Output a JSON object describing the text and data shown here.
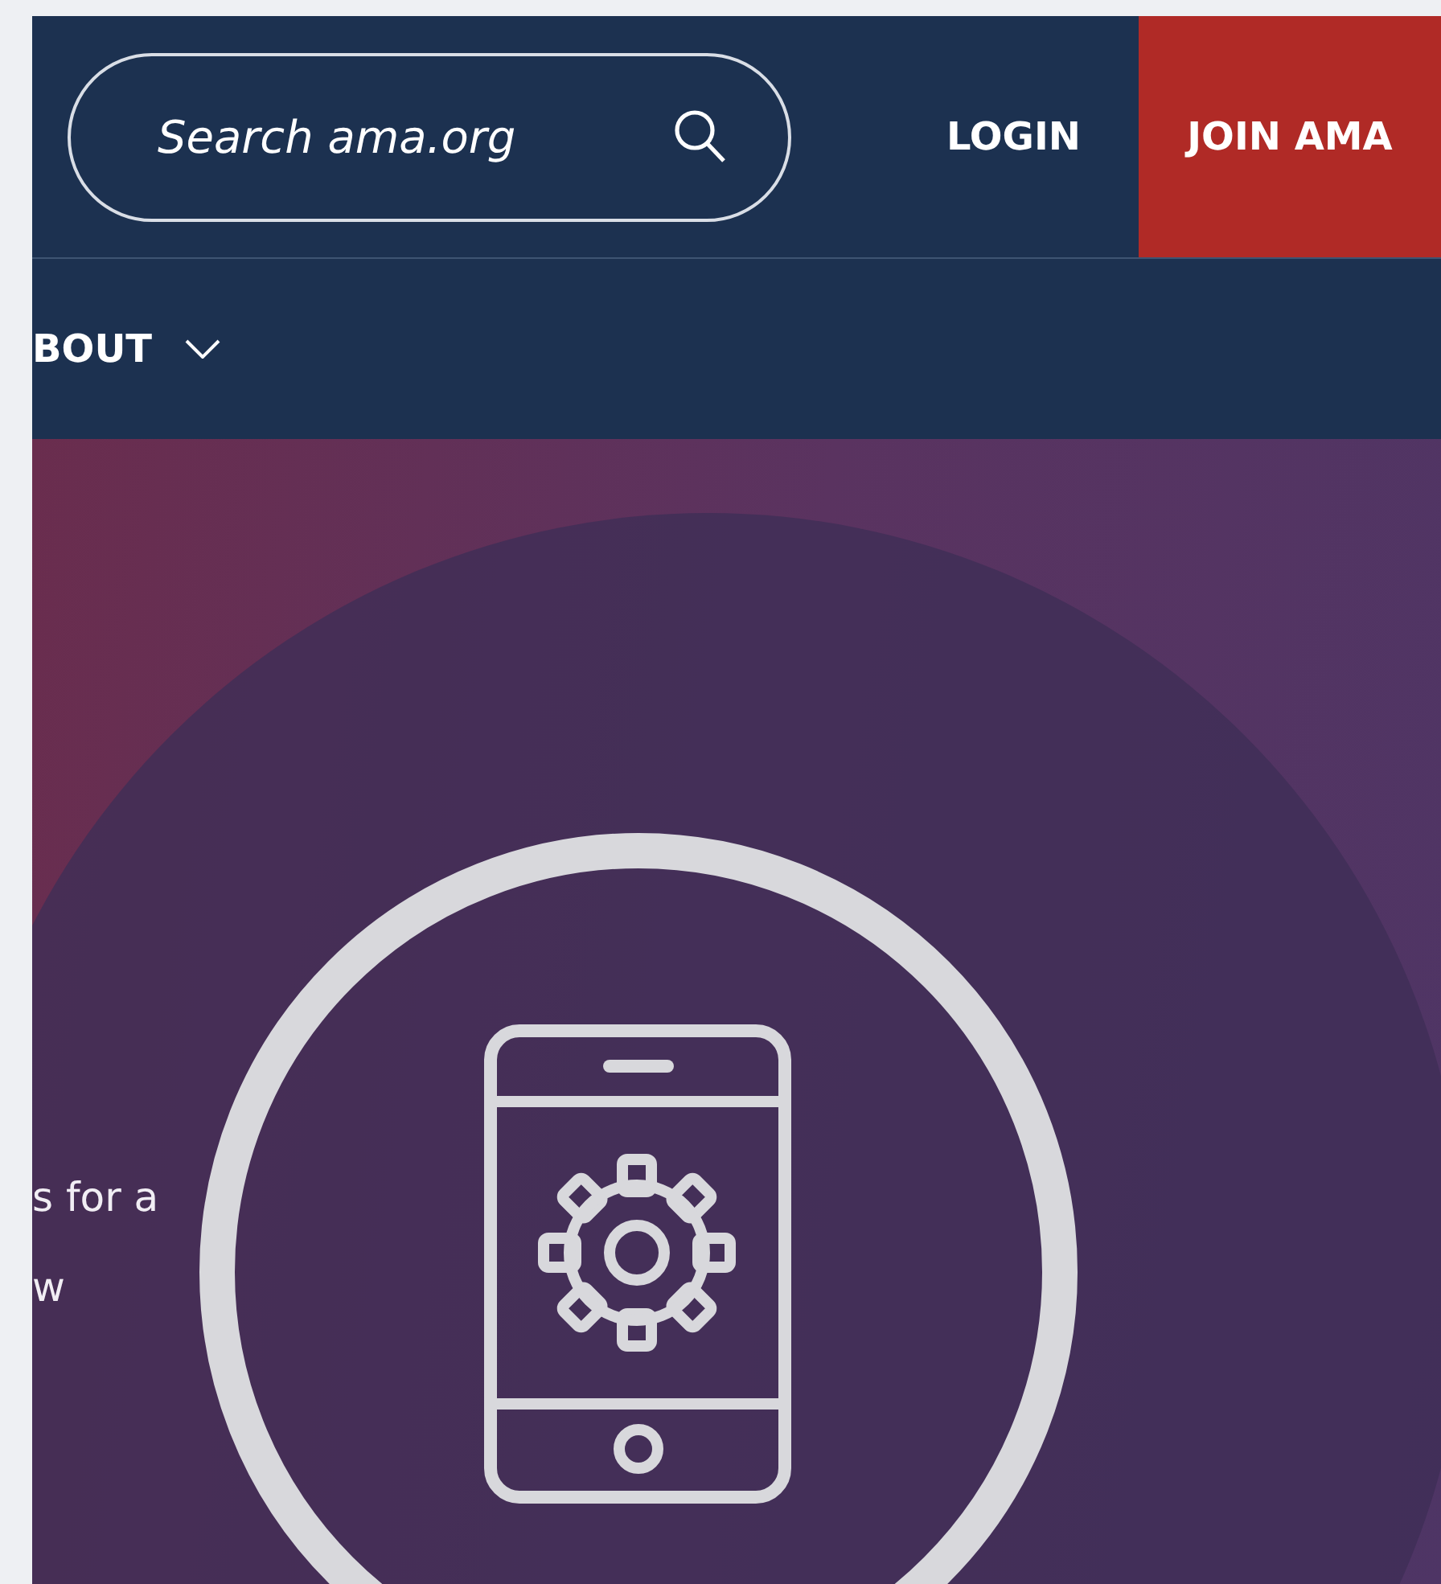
{
  "header": {
    "search": {
      "placeholder": "Search ama.org"
    },
    "login": "LOGIN",
    "join": "JOIN AMA"
  },
  "nav": {
    "items": [
      {
        "label": "BOUT",
        "expanded": false
      }
    ]
  },
  "hero": {
    "text_lines": [
      "s for a",
      "w"
    ]
  }
}
